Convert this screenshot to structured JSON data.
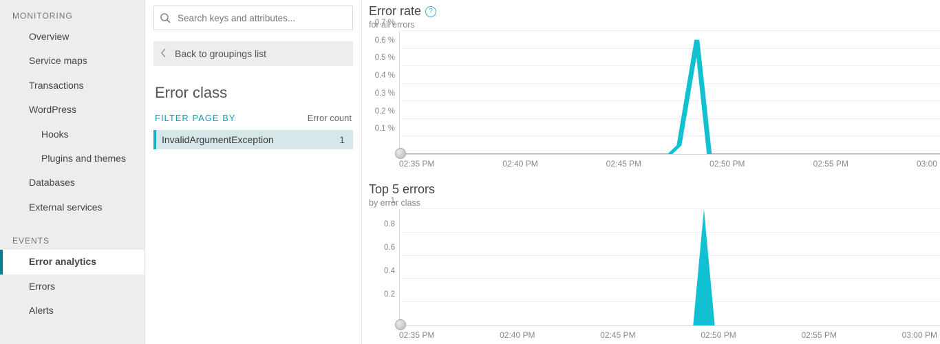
{
  "sidebar": {
    "group_monitoring_label": "MONITORING",
    "group_events_label": "EVENTS",
    "items_monitoring": [
      {
        "label": "Overview"
      },
      {
        "label": "Service maps"
      },
      {
        "label": "Transactions"
      },
      {
        "label": "WordPress"
      },
      {
        "label": "Hooks",
        "indent": 2
      },
      {
        "label": "Plugins and themes",
        "indent": 2
      },
      {
        "label": "Databases"
      },
      {
        "label": "External services"
      }
    ],
    "items_events": [
      {
        "label": "Error analytics",
        "active": true
      },
      {
        "label": "Errors"
      },
      {
        "label": "Alerts"
      }
    ]
  },
  "search": {
    "placeholder": "Search keys and attributes..."
  },
  "back": {
    "label": "Back to groupings list"
  },
  "middle": {
    "heading": "Error class",
    "filter_by_label": "FILTER PAGE BY",
    "error_count_head": "Error count",
    "rows": [
      {
        "name": "InvalidArgumentException",
        "count": "1"
      }
    ]
  },
  "charts": {
    "rate": {
      "title": "Error rate",
      "subtitle": "for all errors",
      "help": "?"
    },
    "top5": {
      "title": "Top 5 errors",
      "subtitle": "by error class"
    }
  },
  "chart_data": [
    {
      "type": "line",
      "title": "Error rate",
      "subtitle": "for all errors",
      "ylabel": "",
      "xlabel": "",
      "ylim": [
        0,
        0.7
      ],
      "y_tick_labels": [
        "0.1 %",
        "0.2 %",
        "0.3 %",
        "0.4 %",
        "0.5 %",
        "0.6 %",
        "0.7 %"
      ],
      "x_tick_labels": [
        "02:35 PM",
        "02:40 PM",
        "02:45 PM",
        "02:50 PM",
        "02:55 PM",
        "03:00"
      ],
      "series": [
        {
          "name": "error rate",
          "color": "#11c0d1",
          "x_minutes_since_0230": [
            5,
            10,
            15,
            15.5,
            16.5,
            17.2,
            20,
            25,
            30
          ],
          "values_pct": [
            0,
            0,
            0,
            0.05,
            0.65,
            0,
            0,
            0,
            0
          ]
        }
      ]
    },
    {
      "type": "area",
      "title": "Top 5 errors",
      "subtitle": "by error class",
      "ylabel": "",
      "xlabel": "",
      "ylim": [
        0,
        1
      ],
      "y_tick_labels": [
        "0.2",
        "0.4",
        "0.6",
        "0.8",
        "1"
      ],
      "x_tick_labels": [
        "02:35 PM",
        "02:40 PM",
        "02:45 PM",
        "02:50 PM",
        "02:55 PM",
        "03:00 PM"
      ],
      "series": [
        {
          "name": "InvalidArgumentException",
          "color": "#11c0d1",
          "x_minutes_since_0230": [
            16.3,
            16.9,
            17.5
          ],
          "values": [
            0,
            1,
            0
          ]
        }
      ]
    }
  ]
}
